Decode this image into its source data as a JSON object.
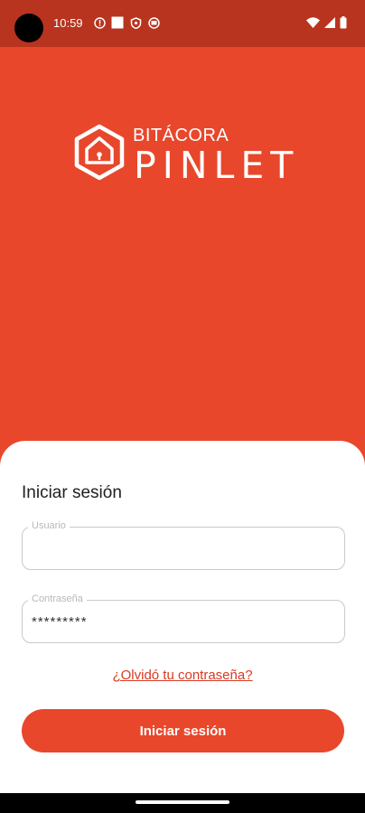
{
  "status_bar": {
    "time": "10:59",
    "left_icons": [
      "alert-circle-icon",
      "square-notification-icon",
      "shield-icon",
      "app-notification-icon"
    ],
    "right_icons": [
      "wifi-icon",
      "signal-icon",
      "battery-icon"
    ]
  },
  "brand": {
    "top_text": "BITÁCORA",
    "main_text": "PINLET",
    "logo_icon": "house-shield-icon"
  },
  "login": {
    "title": "Iniciar sesión",
    "username": {
      "label": "Usuario",
      "value": ""
    },
    "password": {
      "label": "Contraseña",
      "value": "*********"
    },
    "forgot_link": "¿Olvidó tu contraseña?",
    "submit_label": "Iniciar sesión"
  },
  "colors": {
    "primary": "#e8472b",
    "status_bar": "#b8341f",
    "link": "#d93a22"
  }
}
